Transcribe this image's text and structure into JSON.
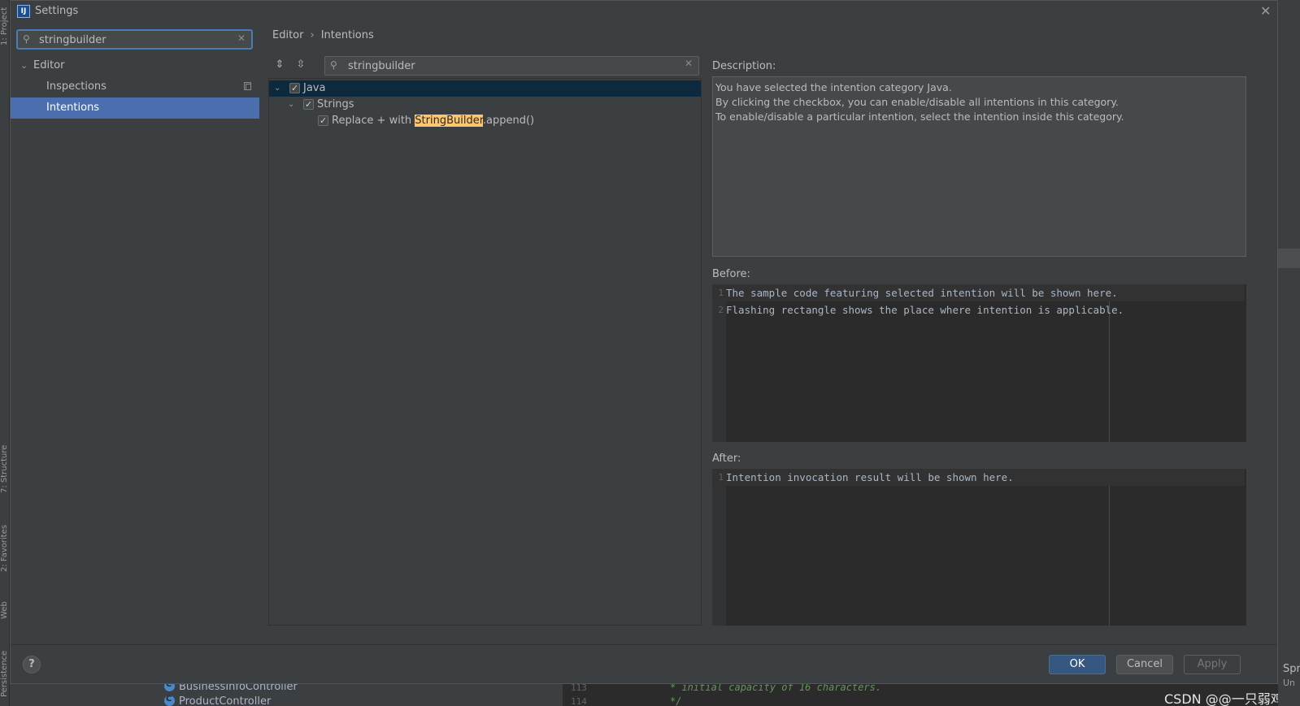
{
  "ide": {
    "side_tabs": [
      "1: Project",
      "7: Structure",
      "2: Favorites",
      "Web",
      "Persistence"
    ],
    "project_tree": [
      "BusinessInfoController",
      "ProductController"
    ],
    "gutter_lines": [
      "113",
      "114"
    ],
    "code_lines": [
      "* initial capacity of 16 characters.",
      "*/"
    ],
    "right_fragments": [
      "Spr",
      "Un"
    ],
    "watermark": "CSDN @@一只弱鸡"
  },
  "dialog": {
    "title": "Settings",
    "app_icon": "IJ"
  },
  "left": {
    "search_value": "stringbuilder",
    "tree": {
      "editor": "Editor",
      "inspections": "Inspections",
      "intentions": "Intentions"
    }
  },
  "right": {
    "breadcrumb": [
      "Editor",
      "Intentions"
    ],
    "filter_value": "stringbuilder",
    "intentions_tree": {
      "java": "Java",
      "strings": "Strings",
      "item_prefix": "Replace + with ",
      "item_highlight": "StringBuilder",
      "item_suffix": ".append()"
    },
    "description_label": "Description:",
    "description_lines": [
      "You have selected the intention category Java.",
      "By clicking the checkbox, you can enable/disable all intentions in this category.",
      "To enable/disable a particular intention, select the intention inside this category."
    ],
    "before_label": "Before:",
    "before_lines": [
      "The sample code featuring selected intention will be shown here.",
      "Flashing rectangle shows the place where intention is applicable."
    ],
    "after_label": "After:",
    "after_lines": [
      "Intention invocation result will be shown here."
    ],
    "line_numbers": [
      "1",
      "2"
    ]
  },
  "buttons": {
    "help": "?",
    "ok": "OK",
    "cancel": "Cancel",
    "apply": "Apply"
  },
  "colors": {
    "selection": "#4b6eaf",
    "tree_selection": "#0d293e",
    "highlight": "#ffc66d",
    "ok_button": "#365880"
  }
}
